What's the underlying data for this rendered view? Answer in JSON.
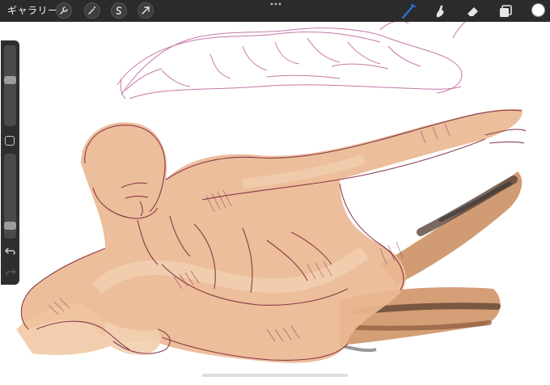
{
  "toolbar": {
    "gallery_label": "ギャラリー",
    "left_icons": [
      "wrench-icon",
      "magic-wand-icon",
      "selection-s-icon",
      "transform-arrow-icon"
    ],
    "right_icons": [
      "brush-icon",
      "smudge-icon",
      "eraser-icon",
      "layers-icon"
    ],
    "active_tool": "brush-icon",
    "active_tool_color": "#2f6fd6",
    "current_color": "#ffffff"
  },
  "sidebar": {
    "brush_size": 0.58,
    "brush_opacity": 0.12
  },
  "canvas": {
    "description_colors": {
      "skin": "#e8b890",
      "sketch_line": "#7a1f3d",
      "magenta_sketch": "#b14b8a",
      "dark_brush": "#6a4a36"
    }
  }
}
